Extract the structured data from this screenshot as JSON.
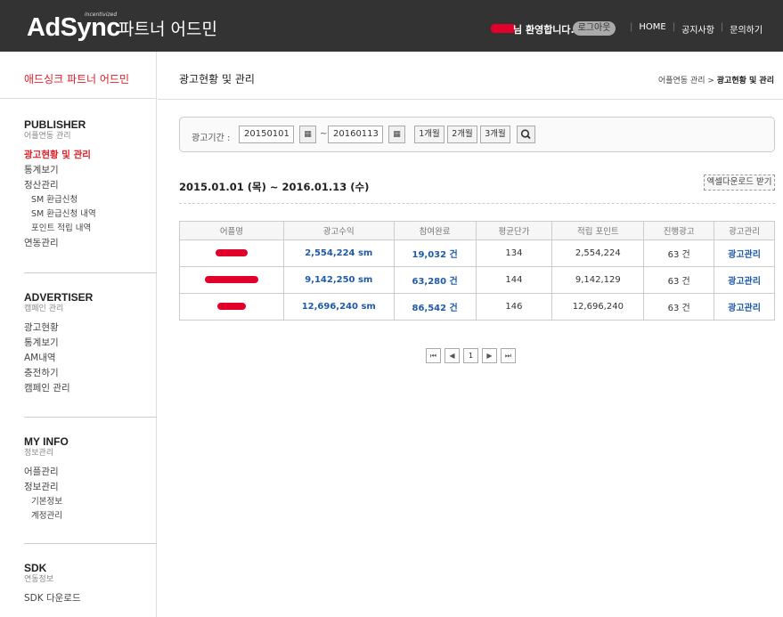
{
  "header": {
    "logo": "AdSync",
    "logo_tag": "incentivized",
    "subtitle": "파트너 어드민",
    "welcome": "님 환영합니다.",
    "logout": "로그아웃",
    "nav": [
      "HOME",
      "공지사항",
      "문의하기"
    ]
  },
  "sidebar": {
    "title": "애드싱크 파트너 어드민",
    "sections": [
      {
        "heading": "PUBLISHER",
        "subheading": "어플연동 관리",
        "items": [
          {
            "label": "광고현황 및 관리",
            "active": true,
            "sub": false
          },
          {
            "label": "통계보기",
            "active": false,
            "sub": false
          },
          {
            "label": "정산관리",
            "active": false,
            "sub": false
          },
          {
            "label": "SM 환급신청",
            "active": false,
            "sub": true
          },
          {
            "label": "SM 환급신청 내역",
            "active": false,
            "sub": true
          },
          {
            "label": "포인트 적립 내역",
            "active": false,
            "sub": true
          },
          {
            "label": "연동관리",
            "active": false,
            "sub": false
          }
        ]
      },
      {
        "heading": "ADVERTISER",
        "subheading": "캠페인 관리",
        "items": [
          {
            "label": "광고현황",
            "active": false,
            "sub": false
          },
          {
            "label": "통계보기",
            "active": false,
            "sub": false
          },
          {
            "label": "AM내역",
            "active": false,
            "sub": false
          },
          {
            "label": "충전하기",
            "active": false,
            "sub": false
          },
          {
            "label": "캠페인 관리",
            "active": false,
            "sub": false
          }
        ]
      },
      {
        "heading": "MY INFO",
        "subheading": "정보관리",
        "items": [
          {
            "label": "어플관리",
            "active": false,
            "sub": false
          },
          {
            "label": "정보관리",
            "active": false,
            "sub": false
          },
          {
            "label": "기본정보",
            "active": false,
            "sub": true
          },
          {
            "label": "계정관리",
            "active": false,
            "sub": true
          }
        ]
      },
      {
        "heading": "SDK",
        "subheading": "연동정보",
        "items": [
          {
            "label": "SDK 다운로드",
            "active": false,
            "sub": false
          }
        ]
      }
    ]
  },
  "main": {
    "title": "광고현황 및 관리",
    "breadcrumb_parent": "어플연동 관리",
    "breadcrumb_sep": " > ",
    "breadcrumb_current": "광고현황 및 관리",
    "search": {
      "label": "광고기간 :",
      "start_date": "20150101",
      "tilde": "~",
      "end_date": "20160113",
      "periods": [
        "1개월",
        "2개월",
        "3개월"
      ]
    },
    "date_range": "2015.01.01 (목) ~ 2016.01.13 (수)",
    "excel_button": "엑셀다운로드 받기",
    "table": {
      "headers": [
        "어플명",
        "광고수익",
        "참여완료",
        "평균단가",
        "적립 포인트",
        "진행광고",
        "광고관리"
      ],
      "rows": [
        {
          "revenue": "2,554,224 sm",
          "completed": "19,032 건",
          "avg_price": "134",
          "points": "2,554,224",
          "active_ads": "63 건",
          "manage": "광고관리"
        },
        {
          "revenue": "9,142,250 sm",
          "completed": "63,280 건",
          "avg_price": "144",
          "points": "9,142,129",
          "active_ads": "63 건",
          "manage": "광고관리"
        },
        {
          "revenue": "12,696,240 sm",
          "completed": "86,542 건",
          "avg_price": "146",
          "points": "12,696,240",
          "active_ads": "63 건",
          "manage": "광고관리"
        }
      ]
    },
    "pagination": {
      "first": "⏮",
      "prev": "◀",
      "current": "1",
      "next": "▶",
      "last": "⏭"
    }
  },
  "colors": {
    "header_bg": "#333333",
    "accent_red": "#e31c25",
    "link_blue": "#1f5aa8"
  }
}
